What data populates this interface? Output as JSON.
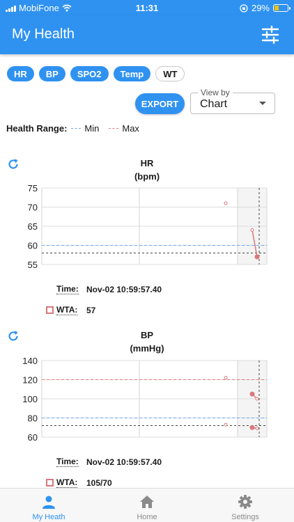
{
  "status_bar": {
    "carrier": "MobiFone",
    "time": "11:31",
    "battery": "29%",
    "battery_level": 0.29
  },
  "app_bar": {
    "title": "My Health",
    "filter_icon": "sliders-icon"
  },
  "tabs": [
    {
      "label": "HR",
      "active": true
    },
    {
      "label": "BP",
      "active": true
    },
    {
      "label": "SPO2",
      "active": true
    },
    {
      "label": "Temp",
      "active": true
    },
    {
      "label": "WT",
      "active": false
    }
  ],
  "export_label": "EXPORT",
  "view_by": {
    "label": "View by",
    "value": "Chart"
  },
  "health_range": {
    "title": "Health Range:",
    "min_label": "Min",
    "max_label": "Max",
    "min_color": "#6aa8ee",
    "max_color": "#e07a7a"
  },
  "chart_data": [
    {
      "type": "line",
      "title": "HR",
      "unit": "(bpm)",
      "ylim": [
        55,
        75
      ],
      "yticks": [
        75,
        70,
        65,
        60,
        55
      ],
      "min_line": 60,
      "crosshair_value": 58,
      "series": [
        {
          "values": [
            71,
            64,
            57
          ]
        }
      ],
      "tooltip": {
        "time_label": "Time:",
        "time": "Nov-02 10:59:57.40",
        "series_label": "WTA:",
        "value": "57"
      }
    },
    {
      "type": "line",
      "title": "BP",
      "unit": "(mmHg)",
      "ylim": [
        60,
        140
      ],
      "yticks": [
        140,
        120,
        100,
        80,
        60
      ],
      "min_line": 80,
      "max_line": 120,
      "crosshair_value": 72,
      "series": [
        {
          "values": [
            122,
            105,
            100
          ]
        },
        {
          "values": [
            73,
            70,
            69
          ]
        }
      ],
      "tooltip": {
        "time_label": "Time:",
        "time": "Nov-02 10:59:57.40",
        "series_label": "WTA:",
        "value": "105/70"
      }
    }
  ],
  "nav": [
    {
      "label": "My Heath",
      "icon": "person-icon",
      "active": true
    },
    {
      "label": "Home",
      "icon": "home-icon",
      "active": false
    },
    {
      "label": "Settings",
      "icon": "gear-icon",
      "active": false
    }
  ]
}
